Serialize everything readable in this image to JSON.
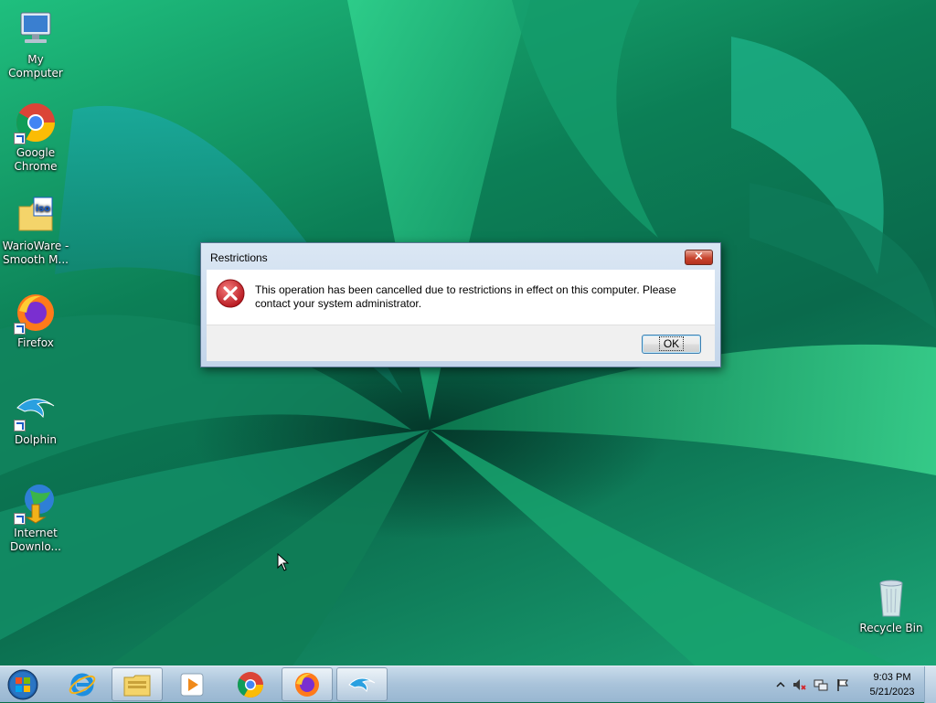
{
  "desktop": {
    "icons": [
      {
        "label": "My Computer",
        "icon": "computer-icon"
      },
      {
        "label": "Google Chrome",
        "icon": "chrome-icon"
      },
      {
        "label": "WarioWare - Smooth M...",
        "icon": "iso-file-icon"
      },
      {
        "label": "Firefox",
        "icon": "firefox-icon"
      },
      {
        "label": "Dolphin",
        "icon": "dolphin-icon"
      },
      {
        "label": "Internet Downlo...",
        "icon": "internet-download-manager-icon"
      },
      {
        "label": "Recycle Bin",
        "icon": "recycle-bin-icon"
      }
    ]
  },
  "dialog": {
    "title": "Restrictions",
    "close_label": "×",
    "message": "This operation has been cancelled due to restrictions in effect on this computer. Please contact your system administrator.",
    "ok_label": "OK",
    "icon": "error-icon"
  },
  "taskbar": {
    "start_icon": "windows-start-icon",
    "pinned": [
      {
        "icon": "internet-explorer-icon"
      },
      {
        "icon": "file-explorer-icon",
        "active": true
      },
      {
        "icon": "media-player-icon"
      },
      {
        "icon": "chrome-icon"
      },
      {
        "icon": "firefox-icon",
        "active": true
      },
      {
        "icon": "dolphin-icon",
        "active": true
      }
    ],
    "tray": {
      "icons": [
        "show-hidden-icons-chevron",
        "speaker-muted-icon",
        "network-icon",
        "action-center-flag-icon"
      ],
      "time": "9:03 PM",
      "date": "5/21/2023"
    }
  },
  "colors": {
    "desktop_green": "#0a6f4a",
    "taskbar": "#a9c3da",
    "close_button": "#c8452f",
    "error_red": "#d4242a"
  }
}
